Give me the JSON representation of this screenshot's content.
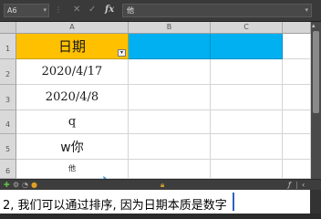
{
  "formula_bar": {
    "cell_ref": "A6",
    "cancel_icon": "close-icon",
    "confirm_icon": "check-icon",
    "fx_label": "fx",
    "content": "他"
  },
  "sheet": {
    "corner": "",
    "columns": [
      "A",
      "B",
      "C"
    ],
    "rows": [
      {
        "num": "1",
        "a": "日期",
        "b": "",
        "c": ""
      },
      {
        "num": "2",
        "a": "2020/4/17",
        "b": "",
        "c": ""
      },
      {
        "num": "3",
        "a": "2020/4/8",
        "b": "",
        "c": ""
      },
      {
        "num": "4",
        "a": "q",
        "b": "",
        "c": ""
      },
      {
        "num": "5",
        "a": "w你",
        "b": "",
        "c": ""
      },
      {
        "num": "6",
        "a": "他",
        "b": "",
        "c": ""
      }
    ],
    "colors": {
      "header_a": "#ffc000",
      "header_bc": "#00b0f0"
    },
    "filter_icon": "filter-dropdown-icon"
  },
  "status_bar": {
    "fx_label": "ƒ",
    "end_glyph": "‹"
  },
  "subtitle": {
    "text": "2, 我们可以通过排序, 因为日期本质是数字"
  }
}
